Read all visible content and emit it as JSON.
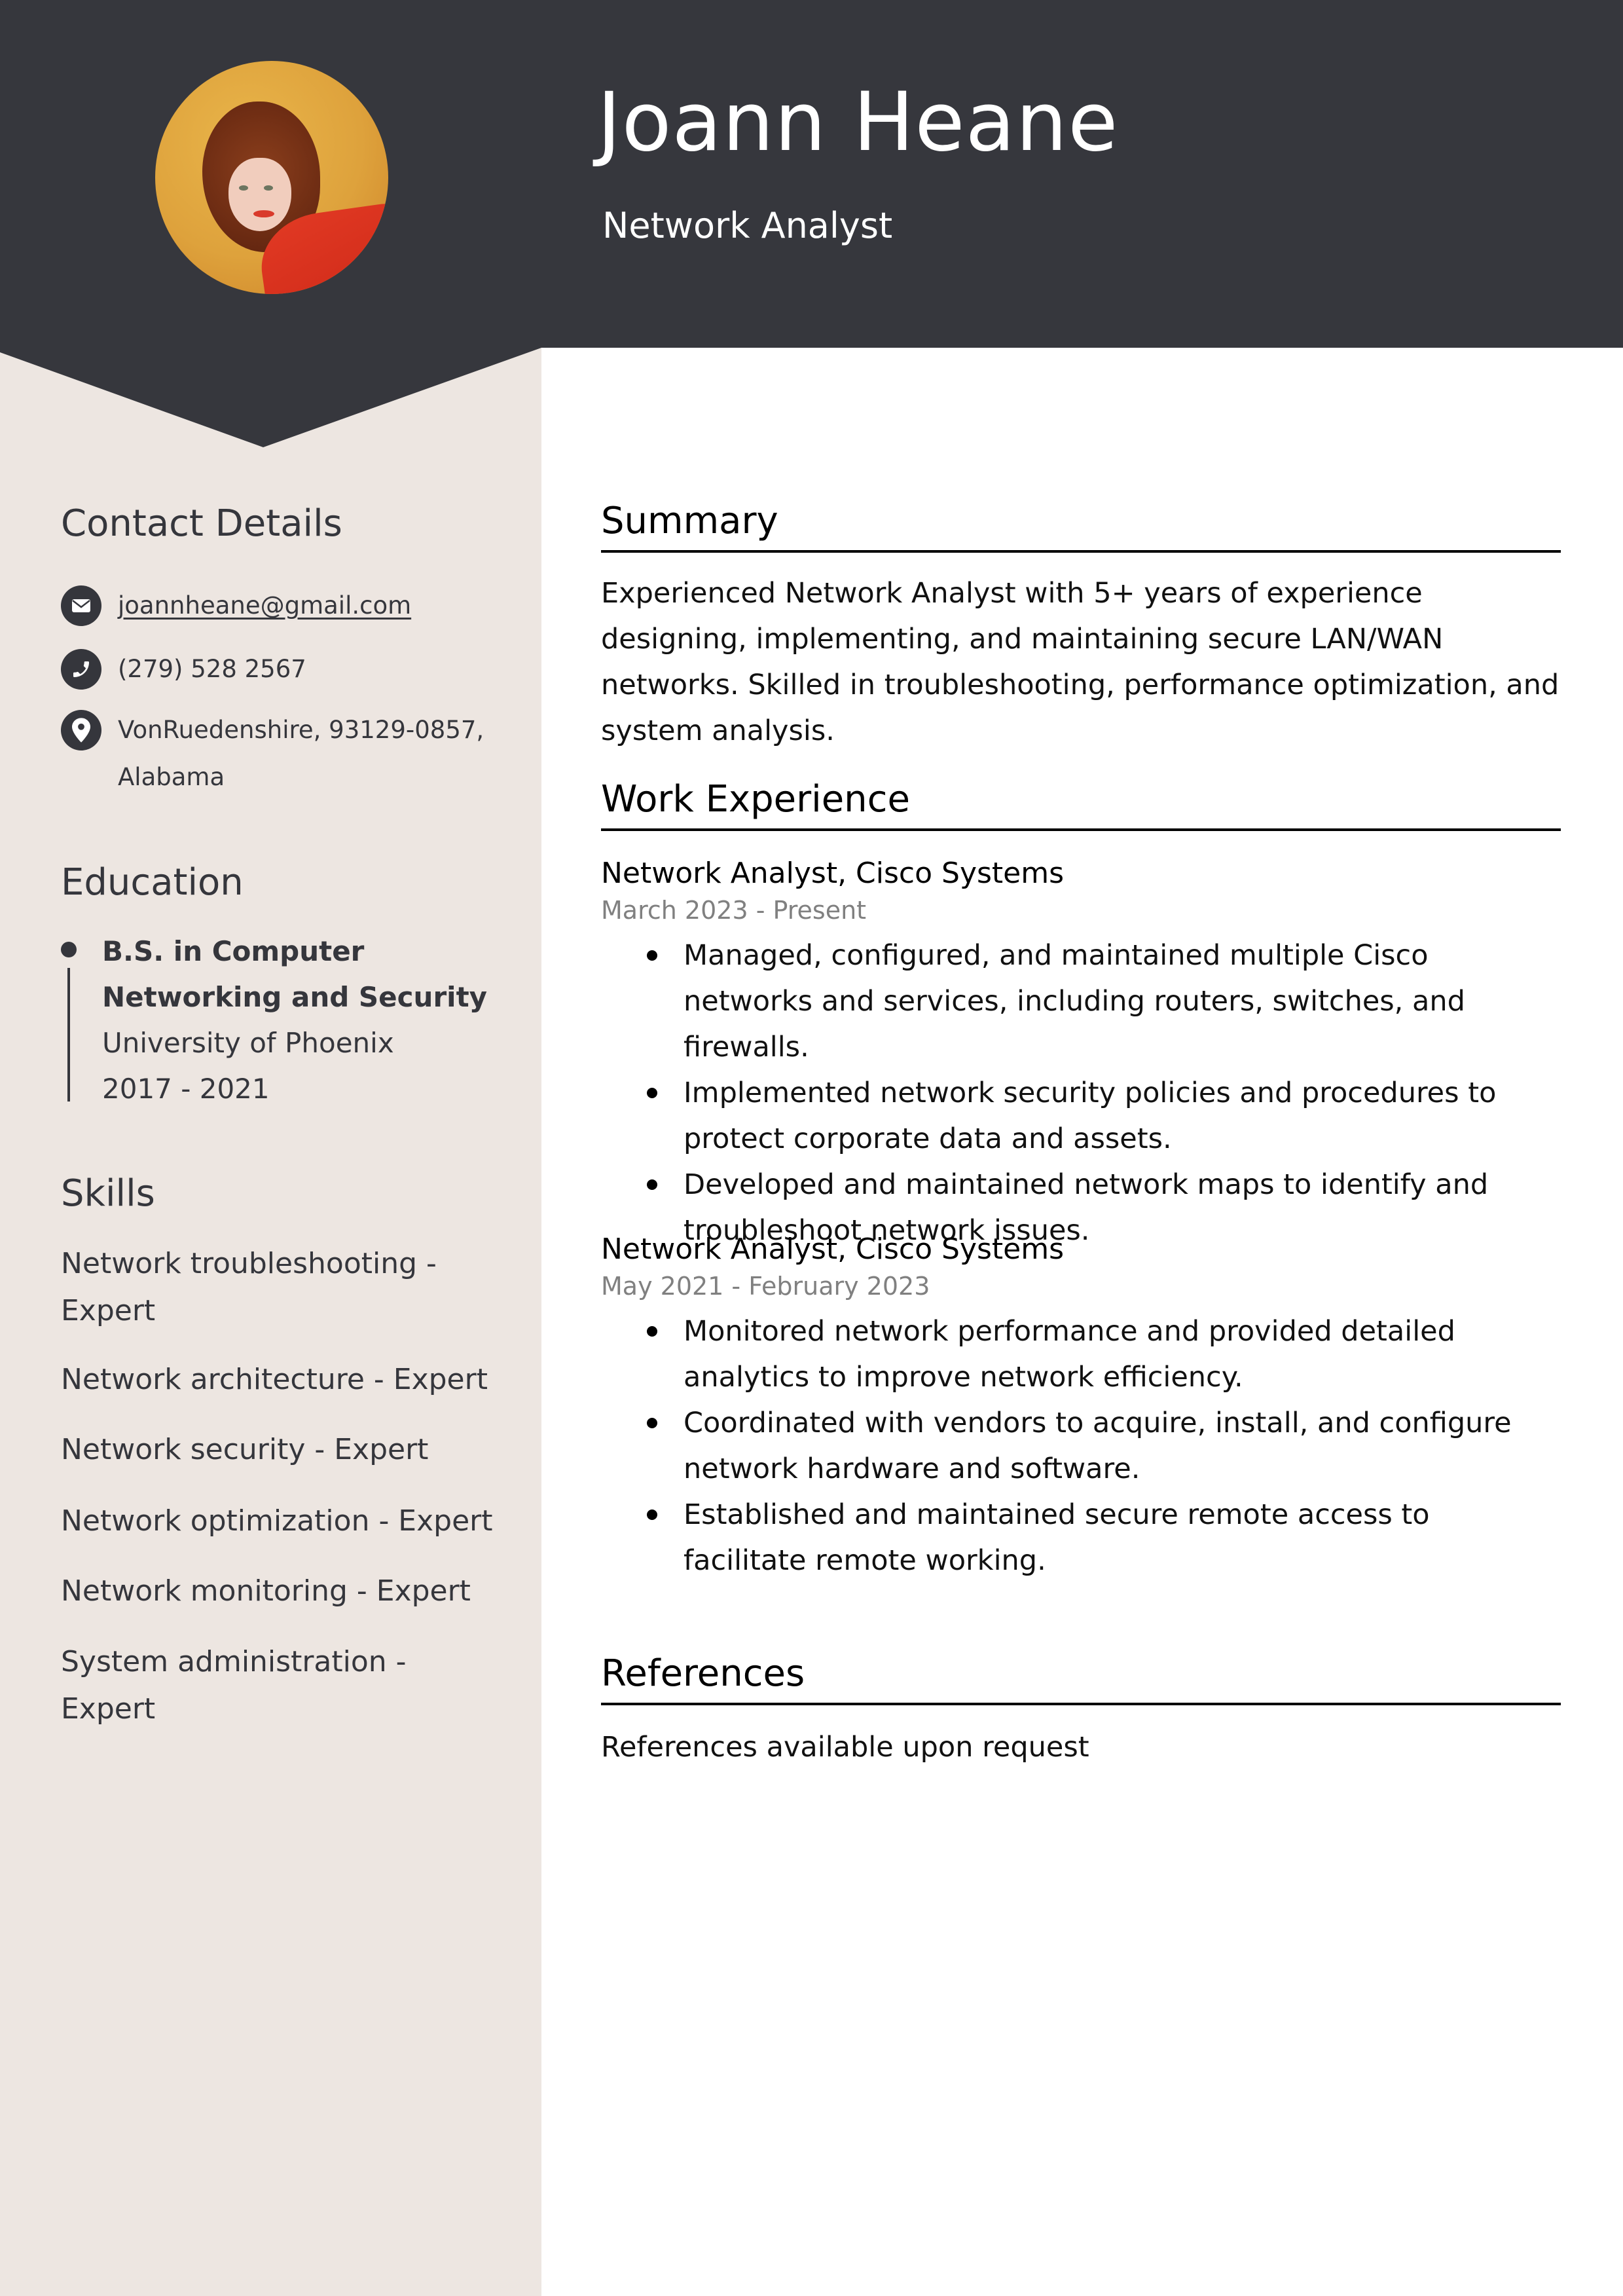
{
  "header": {
    "name": "Joann Heane",
    "title": "Network Analyst",
    "photo_alt": "profile-photo",
    "colors": {
      "header_bg": "#36373d",
      "sidebar_bg": "#ede6e1"
    }
  },
  "contact": {
    "heading": "Contact Details",
    "items": [
      {
        "icon": "envelope-icon",
        "text": "joannheane@gmail.com",
        "type": "email"
      },
      {
        "icon": "phone-icon",
        "text": "(279) 528 2567",
        "type": "phone"
      },
      {
        "icon": "location-pin-icon",
        "text": "VonRuedenshire, 93129-0857, Alabama",
        "type": "address"
      }
    ]
  },
  "education": {
    "heading": "Education",
    "entries": [
      {
        "degree": "B.S. in Computer Networking and Security",
        "school": "University of Phoenix",
        "years": "2017 - 2021"
      }
    ]
  },
  "skills": {
    "heading": "Skills",
    "items": [
      "Network troubleshooting - Expert",
      "Network architecture - Expert",
      "Network security - Expert",
      "Network optimization - Expert",
      "Network monitoring - Expert",
      "System administration - Expert"
    ]
  },
  "summary": {
    "heading": "Summary",
    "text": "Experienced Network Analyst with 5+ years of experience designing, implementing, and maintaining secure LAN/WAN networks. Skilled in troubleshooting, performance optimization, and system analysis."
  },
  "experience": {
    "heading": "Work Experience",
    "jobs": [
      {
        "title": "Network Analyst, Cisco Systems",
        "dates": "March 2023 - Present",
        "bullets": [
          "Managed, configured, and maintained multiple Cisco networks and services, including routers, switches, and firewalls.",
          "Implemented network security policies and procedures to protect corporate data and assets.",
          "Developed and maintained network maps to identify and troubleshoot network issues."
        ]
      },
      {
        "title": "Network Analyst, Cisco Systems",
        "dates": "May 2021 - February 2023",
        "bullets": [
          "Monitored network performance and provided detailed analytics to improve network efficiency.",
          "Coordinated with vendors to acquire, install, and configure network hardware and software.",
          "Established and maintained secure remote access to facilitate remote working."
        ]
      }
    ]
  },
  "references": {
    "heading": "References",
    "text": "References available upon request"
  }
}
